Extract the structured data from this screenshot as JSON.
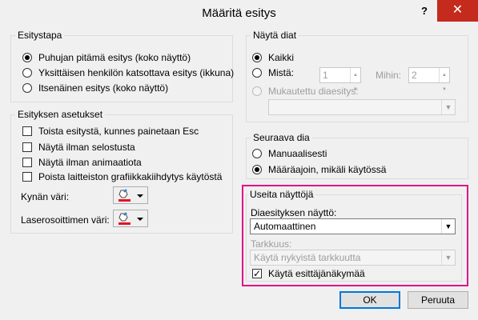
{
  "window": {
    "title": "Määritä esitys",
    "help": "?",
    "close": "✕"
  },
  "show_type": {
    "label": "Esitystapa",
    "options": [
      "Puhujan pitämä esitys (koko näyttö)",
      "Yksittäisen henkilön katsottava esitys (ikkuna)",
      "Itsenäinen esitys (koko näyttö)"
    ],
    "selected": 0
  },
  "show_options": {
    "label": "Esityksen asetukset",
    "checkboxes": [
      "Toista esitystä, kunnes painetaan Esc",
      "Näytä ilman selostusta",
      "Näytä ilman animaatiota",
      "Poista laitteiston grafiikkakiihdytys käytöstä"
    ],
    "pen_color_label": "Kynän väri:",
    "laser_color_label": "Laserosoittimen väri:",
    "pen_color": "#e81123",
    "laser_color": "#e81123"
  },
  "show_slides": {
    "label": "Näytä diat",
    "all": "Kaikki",
    "from": "Mistä:",
    "from_value": "1",
    "to": "Mihin:",
    "to_value": "2",
    "custom": "Mukautettu diaesitys:",
    "custom_value": ""
  },
  "advance": {
    "label": "Seuraava dia",
    "manual": "Manuaalisesti",
    "timings": "Määräajoin, mikäli käytössä"
  },
  "monitors": {
    "label": "Useita näyttöjä",
    "monitor_label": "Diaesityksen näyttö:",
    "monitor_value": "Automaattinen",
    "resolution_label": "Tarkkuus:",
    "resolution_value": "Käytä nykyistä tarkkuutta",
    "presenter_view": "Käytä esittäjänäkymää",
    "highlight_color": "#e0128b"
  },
  "buttons": {
    "ok": "OK",
    "cancel": "Peruuta"
  }
}
